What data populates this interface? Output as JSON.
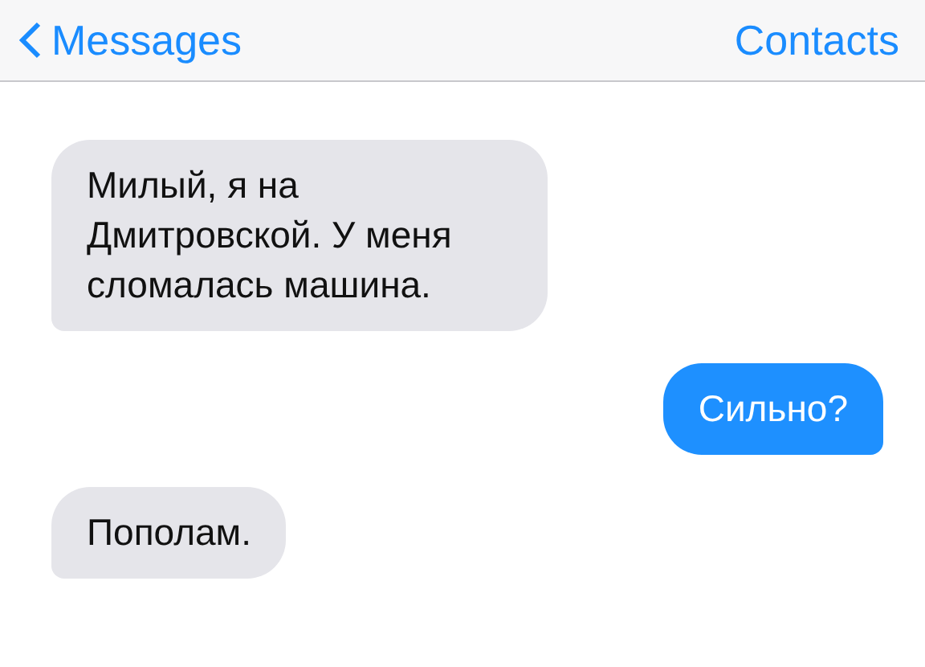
{
  "nav": {
    "back": "Messages",
    "right": "Contacts"
  },
  "messages": [
    {
      "kind": "incoming",
      "text": "Милый, я на Дмитровской. У меня сломалась машина."
    },
    {
      "kind": "outgoing",
      "text": "Сильно?"
    },
    {
      "kind": "incoming",
      "text": "Пополам."
    }
  ]
}
